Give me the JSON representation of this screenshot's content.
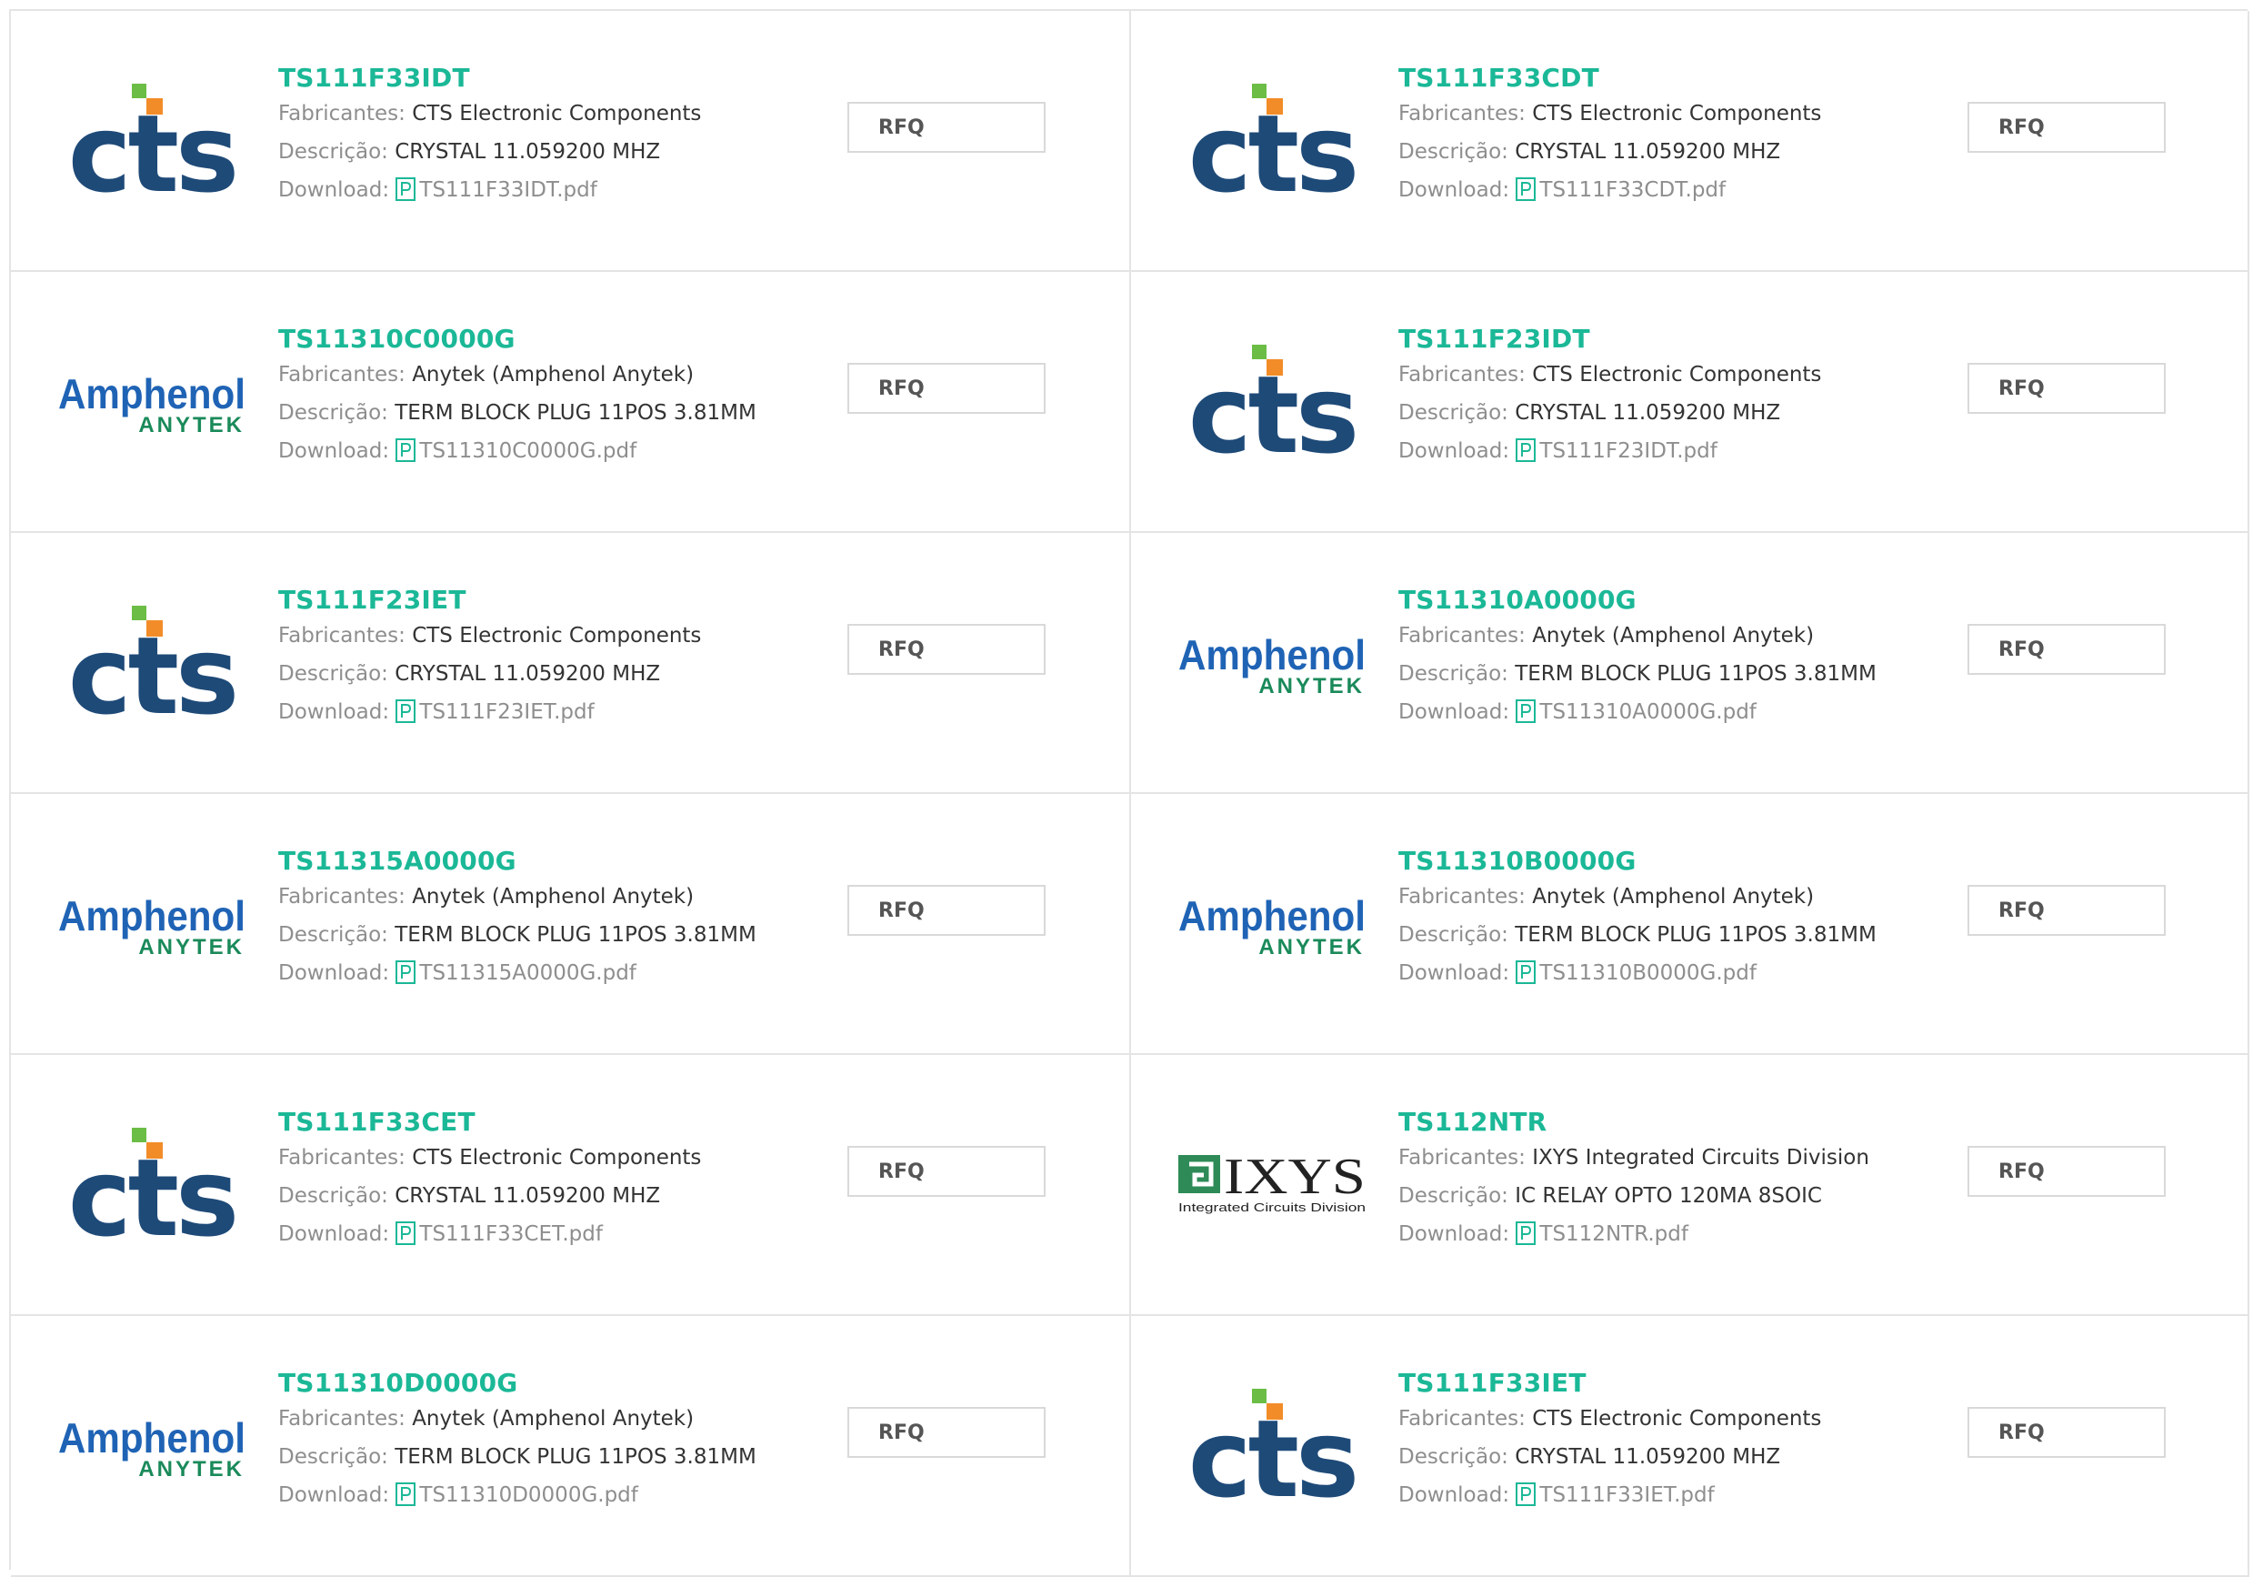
{
  "labels": {
    "manufacturer": "Fabricantes:",
    "description": "Descrição:",
    "download": "Download:",
    "rfq": "RFQ"
  },
  "colors": {
    "part_link": "#1bb897",
    "cts_blue": "#1e4a78",
    "cts_orange": "#f28c28",
    "cts_green": "#6cbd45",
    "amphenol_blue": "#1f63b5",
    "anytek_green": "#1a8a5a",
    "ixys_green": "#2e8b57"
  },
  "products": [
    {
      "part": "TS111F33IDT",
      "logo": "cts-logo",
      "manufacturer": "CTS Electronic Components",
      "description": "CRYSTAL 11.059200 MHZ",
      "file": "TS111F33IDT.pdf"
    },
    {
      "part": "TS111F33CDT",
      "logo": "cts-logo",
      "manufacturer": "CTS Electronic Components",
      "description": "CRYSTAL 11.059200 MHZ",
      "file": "TS111F33CDT.pdf"
    },
    {
      "part": "TS11310C0000G",
      "logo": "amphenol-anytek-logo",
      "manufacturer": "Anytek (Amphenol Anytek)",
      "description": "TERM BLOCK PLUG 11POS 3.81MM",
      "file": "TS11310C0000G.pdf"
    },
    {
      "part": "TS111F23IDT",
      "logo": "cts-logo",
      "manufacturer": "CTS Electronic Components",
      "description": "CRYSTAL 11.059200 MHZ",
      "file": "TS111F23IDT.pdf"
    },
    {
      "part": "TS111F23IET",
      "logo": "cts-logo",
      "manufacturer": "CTS Electronic Components",
      "description": "CRYSTAL 11.059200 MHZ",
      "file": "TS111F23IET.pdf"
    },
    {
      "part": "TS11310A0000G",
      "logo": "amphenol-anytek-logo",
      "manufacturer": "Anytek (Amphenol Anytek)",
      "description": "TERM BLOCK PLUG 11POS 3.81MM",
      "file": "TS11310A0000G.pdf"
    },
    {
      "part": "TS11315A0000G",
      "logo": "amphenol-anytek-logo",
      "manufacturer": "Anytek (Amphenol Anytek)",
      "description": "TERM BLOCK PLUG 11POS 3.81MM",
      "file": "TS11315A0000G.pdf"
    },
    {
      "part": "TS11310B0000G",
      "logo": "amphenol-anytek-logo",
      "manufacturer": "Anytek (Amphenol Anytek)",
      "description": "TERM BLOCK PLUG 11POS 3.81MM",
      "file": "TS11310B0000G.pdf"
    },
    {
      "part": "TS111F33CET",
      "logo": "cts-logo",
      "manufacturer": "CTS Electronic Components",
      "description": "CRYSTAL 11.059200 MHZ",
      "file": "TS111F33CET.pdf"
    },
    {
      "part": "TS112NTR",
      "logo": "ixys-logo",
      "manufacturer": "IXYS Integrated Circuits Division",
      "description": "IC RELAY OPTO 120MA 8SOIC",
      "file": "TS112NTR.pdf"
    },
    {
      "part": "TS11310D0000G",
      "logo": "amphenol-anytek-logo",
      "manufacturer": "Anytek (Amphenol Anytek)",
      "description": "TERM BLOCK PLUG 11POS 3.81MM",
      "file": "TS11310D0000G.pdf"
    },
    {
      "part": "TS111F33IET",
      "logo": "cts-logo",
      "manufacturer": "CTS Electronic Components",
      "description": "CRYSTAL 11.059200 MHZ",
      "file": "TS111F33IET.pdf"
    }
  ],
  "logo_text": {
    "cts": "cts",
    "amphenol": "Amphenol",
    "anytek": "ANYTEK",
    "ixys": "IXYS",
    "ixys_sub": "Integrated Circuits Division"
  }
}
